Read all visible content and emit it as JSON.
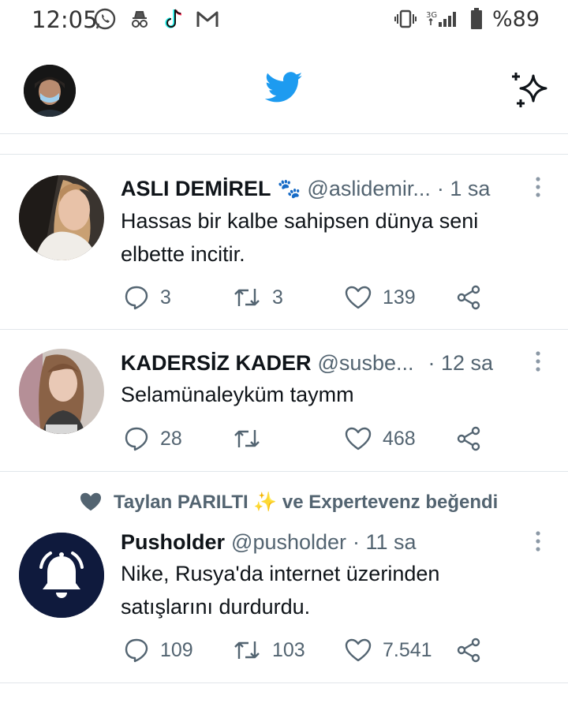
{
  "status_bar": {
    "time": "12:05",
    "battery": "%89",
    "network": "3G"
  },
  "header": {
    "logo": "twitter-bird-icon",
    "sparkle": "sparkle-icon"
  },
  "tweets": [
    {
      "name": "ASLI DEMİREL",
      "name_emoji": "🐾",
      "handle": "@aslidemir...",
      "time": "· 1 sa",
      "text_lines": [
        "Hassas bir kalbe sahipsen dünya seni",
        "elbette incitir."
      ],
      "replies": "3",
      "retweets": "3",
      "likes": "139"
    },
    {
      "name": "KADERSİZ KADER",
      "handle": "@susbe...",
      "time": "· 12 sa",
      "text_lines": [
        "Selamünaleyküm taymm"
      ],
      "replies": "28",
      "retweets": "",
      "likes": "468"
    },
    {
      "social_context": "Taylan PARILTI ✨ ve Expertevenz beğendi",
      "name": "Pusholder",
      "handle": "@pusholder",
      "time": "· 11 sa",
      "text_lines": [
        "Nike, Rusya'da internet üzerinden",
        "satışlarını durdurdu."
      ],
      "replies": "109",
      "retweets": "103",
      "likes": "7.541"
    }
  ],
  "colors": {
    "twitter_blue": "#1d9bf0",
    "secondary_text": "#536471",
    "divider": "#e1e6ea",
    "pusholder_bg": "#0f1a3d"
  }
}
